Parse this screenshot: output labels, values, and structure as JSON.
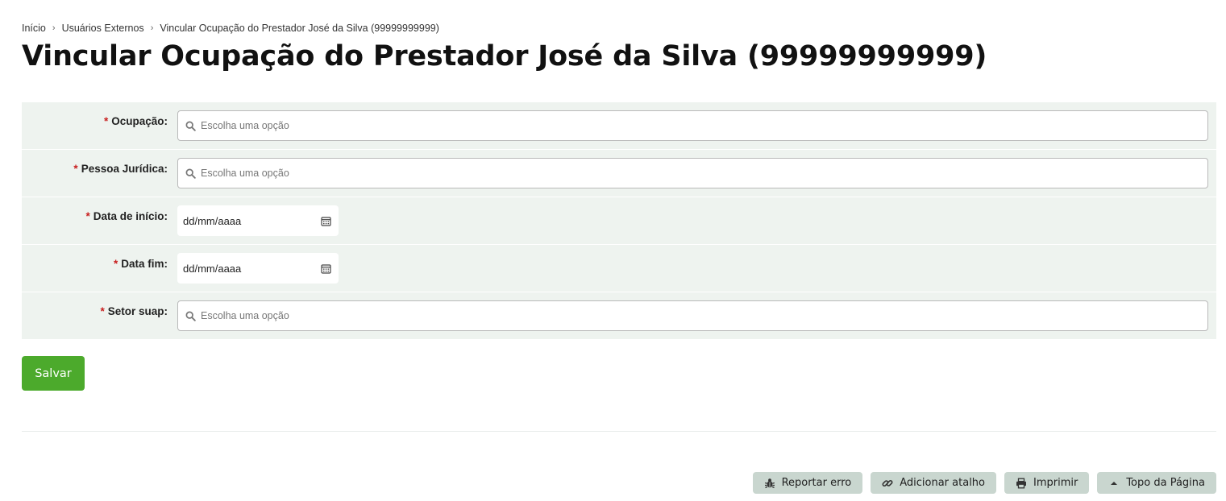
{
  "breadcrumb": {
    "items": [
      "Início",
      "Usuários Externos",
      "Vincular Ocupação do Prestador José da Silva (99999999999)"
    ]
  },
  "title": "Vincular Ocupação do Prestador José da Silva (99999999999)",
  "form": {
    "required_mark": "*",
    "fields": [
      {
        "label": "Ocupação:",
        "type": "select",
        "placeholder": "Escolha uma opção"
      },
      {
        "label": "Pessoa Jurídica:",
        "type": "select",
        "placeholder": "Escolha uma opção"
      },
      {
        "label": "Data de início:",
        "type": "date",
        "value": "dd/mm/aaaa"
      },
      {
        "label": "Data fim:",
        "type": "date",
        "value": "dd/mm/aaaa"
      },
      {
        "label": "Setor suap:",
        "type": "select",
        "placeholder": "Escolha uma opção"
      }
    ],
    "save_label": "Salvar"
  },
  "footer": {
    "actions": [
      {
        "label": "Reportar erro",
        "icon": "bug-icon"
      },
      {
        "label": "Adicionar atalho",
        "icon": "link-icon"
      },
      {
        "label": "Imprimir",
        "icon": "printer-icon"
      },
      {
        "label": "Topo da Página",
        "icon": "caret-up-icon"
      }
    ]
  },
  "colors": {
    "save_button": "#4caa2c",
    "form_background": "#eef3ef",
    "footer_button": "#c9d6cf",
    "required": "#c81e1e"
  }
}
